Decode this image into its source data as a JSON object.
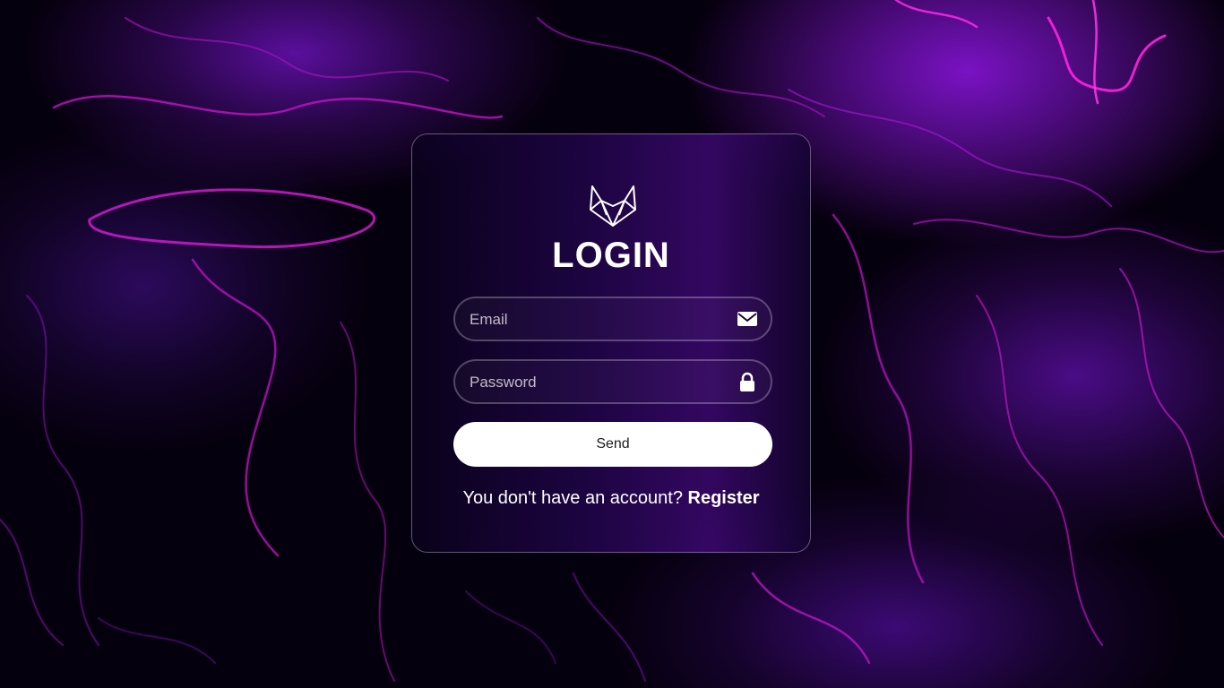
{
  "login": {
    "title": "LOGIN",
    "email_placeholder": "Email",
    "password_placeholder": "Password",
    "send_label": "Send",
    "register_prompt": "You don't have an account?",
    "register_link": "Register"
  },
  "icons": {
    "logo": "fox-logo-icon",
    "email": "envelope-icon",
    "password": "lock-icon"
  },
  "colors": {
    "background": "#05000d",
    "accent_magenta": "#e01ad8",
    "accent_purple": "#7a12c4",
    "button_bg": "#ffffff",
    "text": "#ffffff"
  }
}
